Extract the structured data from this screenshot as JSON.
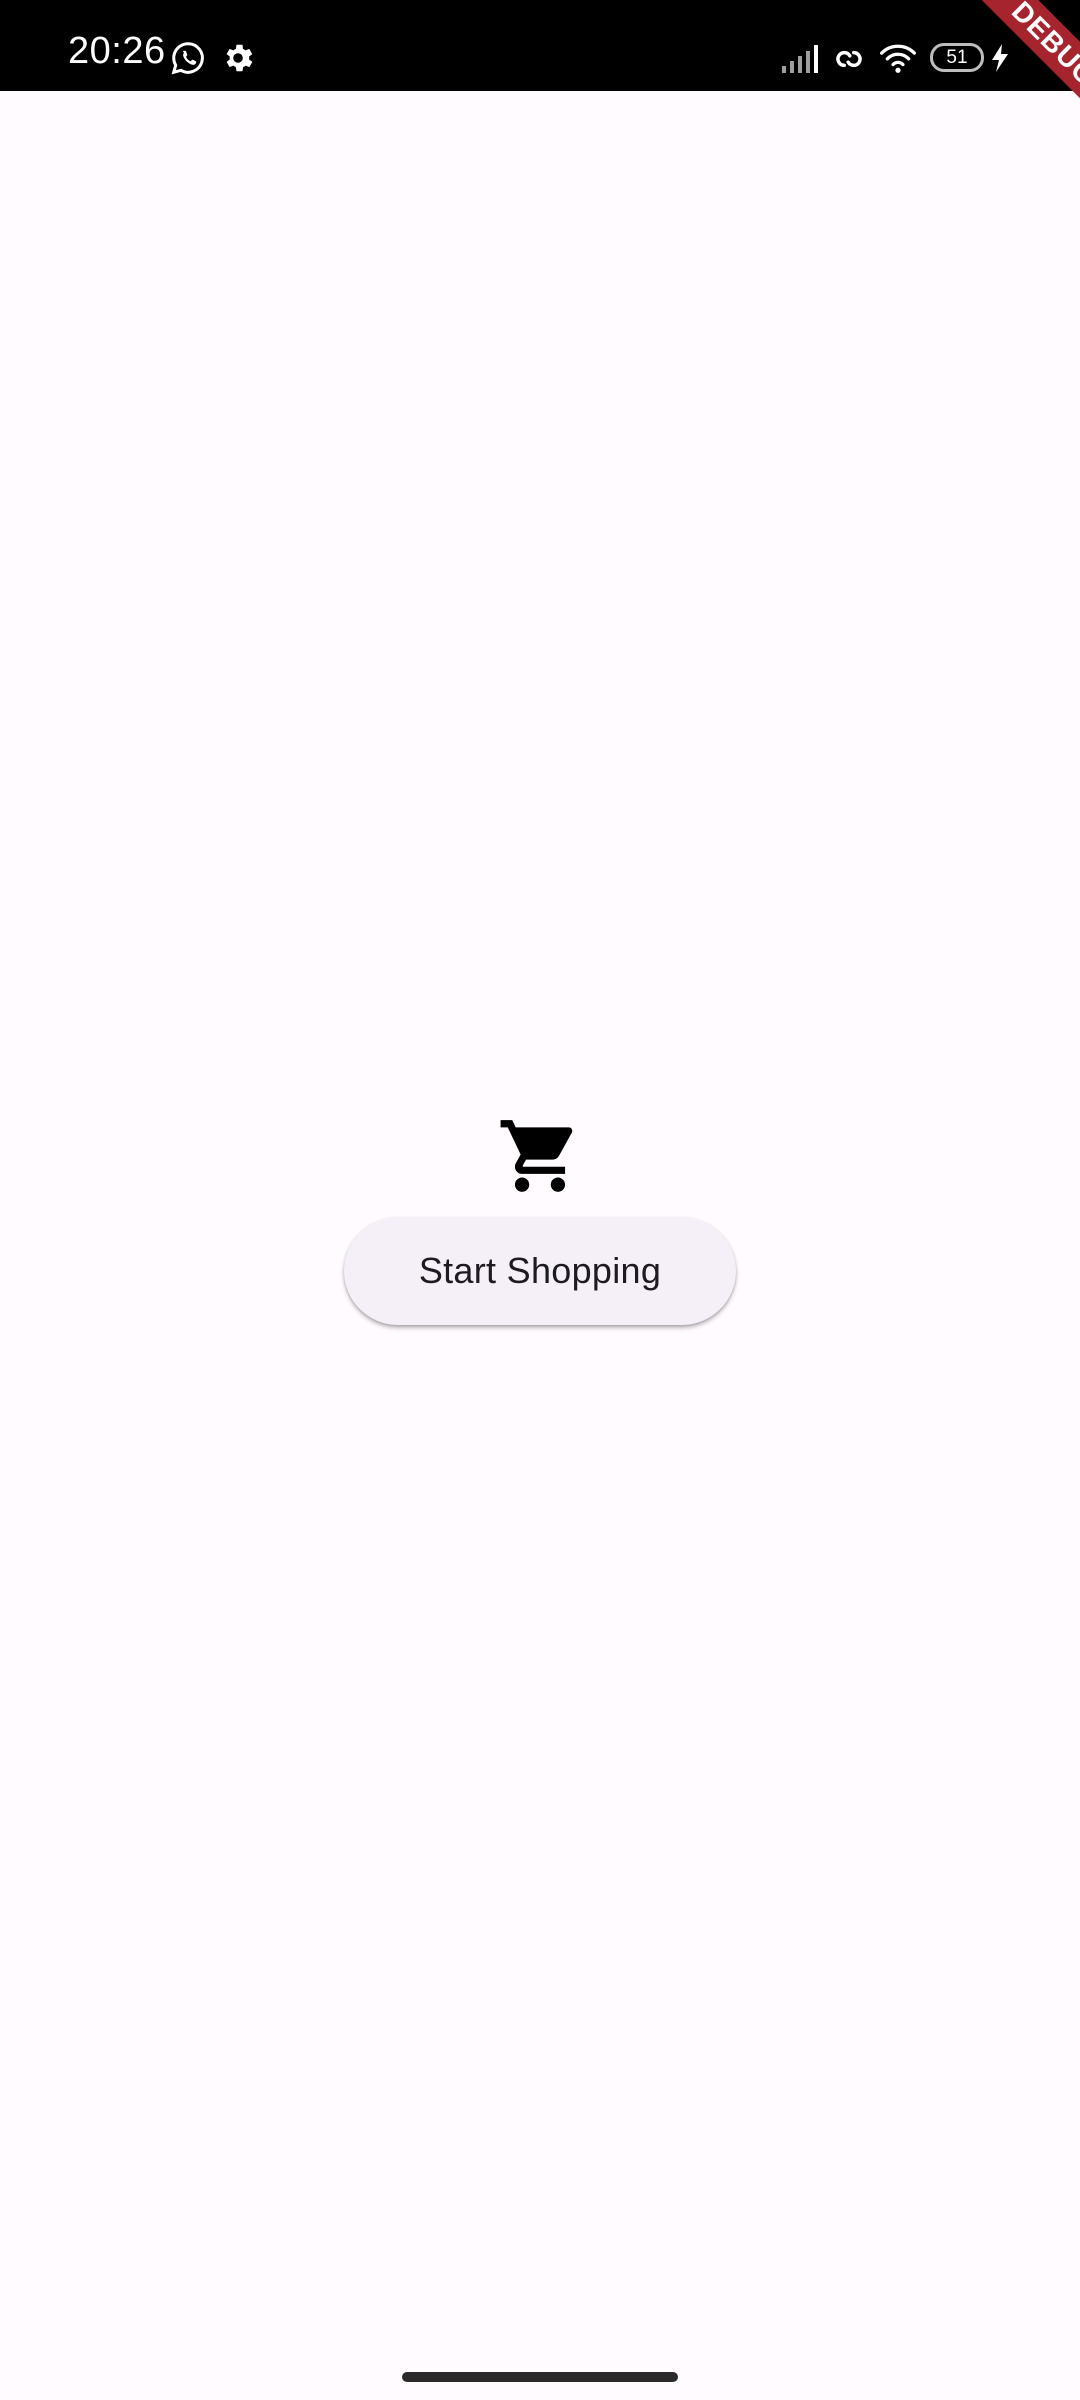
{
  "status_bar": {
    "time": "20:26",
    "battery": "51",
    "icons": [
      "whatsapp-icon",
      "settings-gear-icon",
      "signal-icon",
      "link-icon",
      "wifi-icon",
      "battery-icon",
      "charging-bolt-icon"
    ]
  },
  "debug_banner": {
    "label": "DEBUG",
    "color": "#a6242e"
  },
  "main": {
    "icon": "shopping-cart-icon",
    "button_label": "Start Shopping"
  },
  "colors": {
    "background": "#fffbfe",
    "button_bg": "#f5f0f7",
    "status_bar": "#000000"
  }
}
